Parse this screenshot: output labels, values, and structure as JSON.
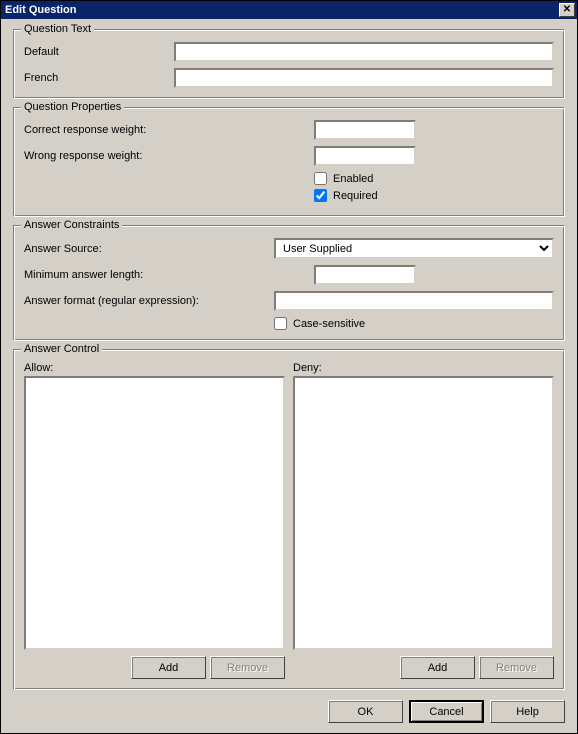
{
  "window": {
    "title": "Edit Question"
  },
  "question_text": {
    "legend": "Question Text",
    "default_label": "Default",
    "default_value": "",
    "french_label": "French",
    "french_value": ""
  },
  "question_properties": {
    "legend": "Question Properties",
    "correct_weight_label": "Correct response weight:",
    "correct_weight_value": "",
    "wrong_weight_label": "Wrong response weight:",
    "wrong_weight_value": "",
    "enabled_label": "Enabled",
    "enabled_checked": false,
    "required_label": "Required",
    "required_checked": true
  },
  "answer_constraints": {
    "legend": "Answer Constraints",
    "source_label": "Answer Source:",
    "source_value": "User Supplied",
    "min_length_label": "Minimum answer length:",
    "min_length_value": "",
    "format_label": "Answer format (regular expression):",
    "format_value": "",
    "case_sensitive_label": "Case-sensitive",
    "case_sensitive_checked": false
  },
  "answer_control": {
    "legend": "Answer Control",
    "allow_label": "Allow:",
    "deny_label": "Deny:",
    "add_label": "Add",
    "remove_label": "Remove"
  },
  "dialog_buttons": {
    "ok": "OK",
    "cancel": "Cancel",
    "help": "Help"
  }
}
